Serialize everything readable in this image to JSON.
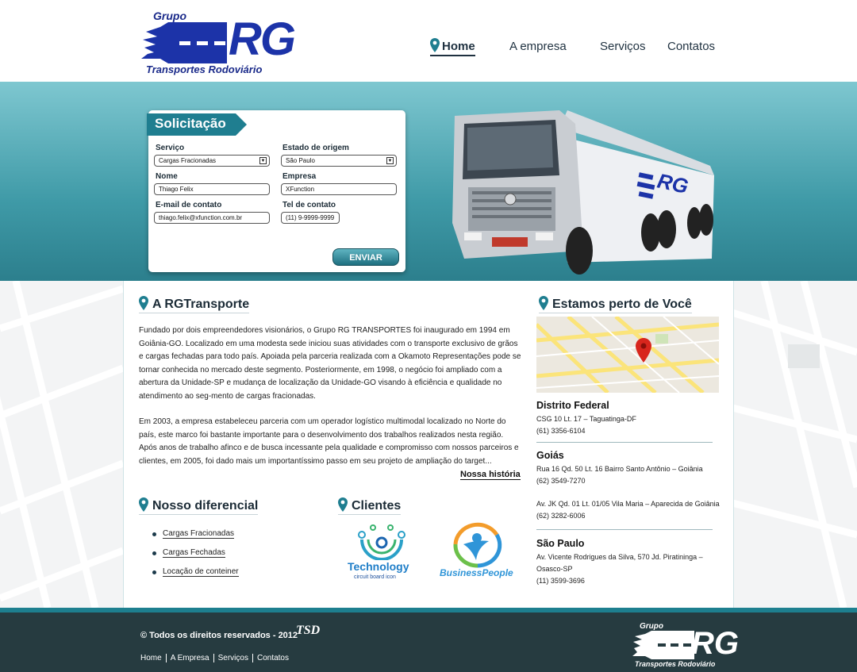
{
  "brand": {
    "group": "Grupo",
    "name": "RG",
    "tagline": "Transportes Rodoviário"
  },
  "nav": {
    "home": "Home",
    "company": "A empresa",
    "services": "Serviços",
    "contacts": "Contatos"
  },
  "form": {
    "title": "Solicitação",
    "service_label": "Serviço",
    "service_value": "Cargas Fracionadas",
    "origin_label": "Estado de origem",
    "origin_value": "São Paulo",
    "name_label": "Nome",
    "name_value": "Thiago Felix",
    "company_label": "Empresa",
    "company_value": "XFunction",
    "email_label": "E-mail de contato",
    "email_value": "thiago.felix@xfunction.com.br",
    "phone_label": "Tel de contato",
    "phone_value": "(11) 9-9999-9999",
    "send": "ENVIAR"
  },
  "about": {
    "title": "A RGTransporte",
    "p1": "Fundado por dois empreendedores visionários, o Grupo RG TRANSPORTES foi inaugurado em 1994 em Goiânia-GO. Localizado em uma modesta sede iniciou suas atividades com o transporte exclusivo de grãos e cargas fechadas para todo país. Apoiada pela parceria realizada com a Okamoto Representações pode se tornar conhecida no mercado deste segmento. Posteriormente, em 1998, o negócio foi ampliado com a abertura da Unidade-SP e mudança de localização da Unidade-GO visando à eficiência e qualidade no atendimento ao seg-mento de cargas fracionadas.",
    "p2": "Em 2003, a empresa estabeleceu parceria com um operador logístico multimodal  localizado no Norte do país, este marco foi bastante importante para o desenvolvimento dos trabalhos realizados nesta região. Após anos de trabalho afinco e de busca incessante pela qualidade e compromisso com nossos parceiros e clientes, em 2005, foi dado mais um importantíssimo passo em seu projeto de ampliação do target...",
    "more": "Nossa história"
  },
  "diferencial": {
    "title": "Nosso diferencial",
    "items": [
      "Cargas Fracionadas",
      "Cargas Fechadas",
      "Locação de conteiner"
    ]
  },
  "clients": {
    "title": "Clientes",
    "c1_name": "Technology",
    "c1_sub": "circuit board icon",
    "c2_name": "BusinessPeople"
  },
  "near": {
    "title": "Estamos perto de Você",
    "df_city": "Distrito Federal",
    "df_addr": "CSG 10 Lt. 17 – Taguatinga-DF",
    "df_phone": "(61) 3356-6104",
    "go_city": "Goiás",
    "go_addr1": "Rua 16 Qd. 50 Lt. 16 Bairro Santo Antônio – Goiânia",
    "go_phone1": "(62) 3549-7270",
    "go_addr2": "Av. JK Qd. 01 Lt. 01/05 Vila Maria – Aparecida de Goiânia",
    "go_phone2": "(62) 3282-6006",
    "sp_city": "São Paulo",
    "sp_addr1": "Av. Vicente Rodrigues da Silva, 570 Jd. Piratininga –",
    "sp_addr2": "Osasco-SP",
    "sp_phone": "(11) 3599-3696"
  },
  "footer": {
    "copyright": "Todos os direitos reservados - 2012",
    "badge": "TSD",
    "links": [
      "Home",
      "A Empresa",
      "Serviços",
      "Contatos"
    ]
  },
  "colors": {
    "teal": "#1f7e90",
    "navy": "#1c33a8",
    "footer": "#263b40",
    "pin": "#1f7e90"
  }
}
